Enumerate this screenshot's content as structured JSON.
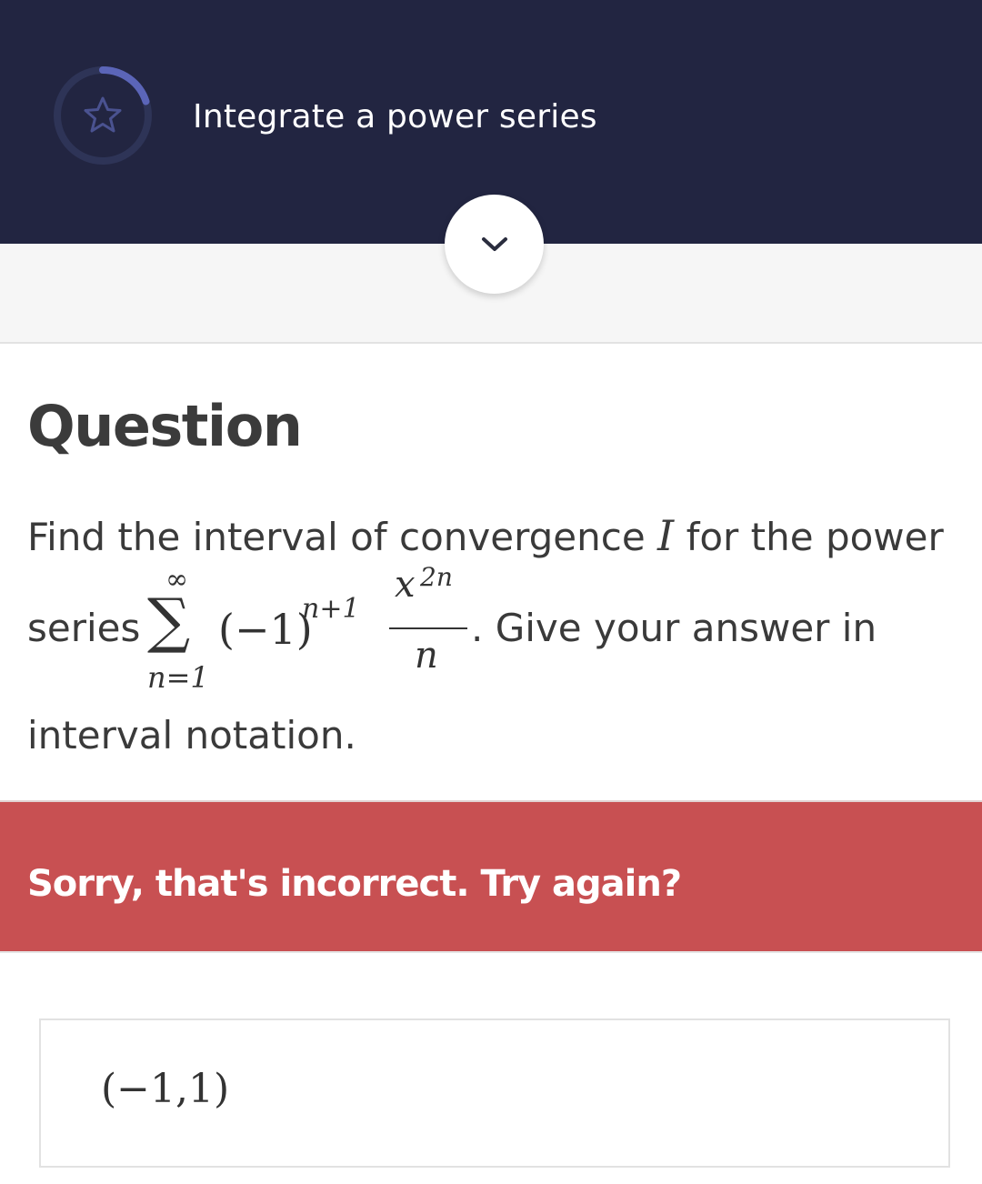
{
  "header": {
    "title": "Integrate a power series",
    "progress_icon": "star-icon",
    "progress_fraction": 0.2,
    "colors": {
      "background": "#222541",
      "ring_track": "#2e3457",
      "ring_fill": "#5b65b8"
    }
  },
  "expand_button": {
    "icon": "chevron-down-icon"
  },
  "question": {
    "heading": "Question",
    "line1_text": "Find the interval of convergence",
    "line1_var": "I",
    "line1_tail": "for the power",
    "line2_lead": "series",
    "sum_upper": "∞",
    "sum_symbol": "∑",
    "sum_lower": "n=1",
    "term_base": "(−1)",
    "term_exponent": "n+1",
    "frac_numerator": "x",
    "frac_numerator_exp": "2n",
    "frac_denominator": "n",
    "line2_tail": ". Give your answer in",
    "line3": "interval notation."
  },
  "feedback": {
    "message": "Sorry, that's incorrect. Try again?",
    "color": "#c85052"
  },
  "answer": {
    "value": "(−1,1)"
  }
}
